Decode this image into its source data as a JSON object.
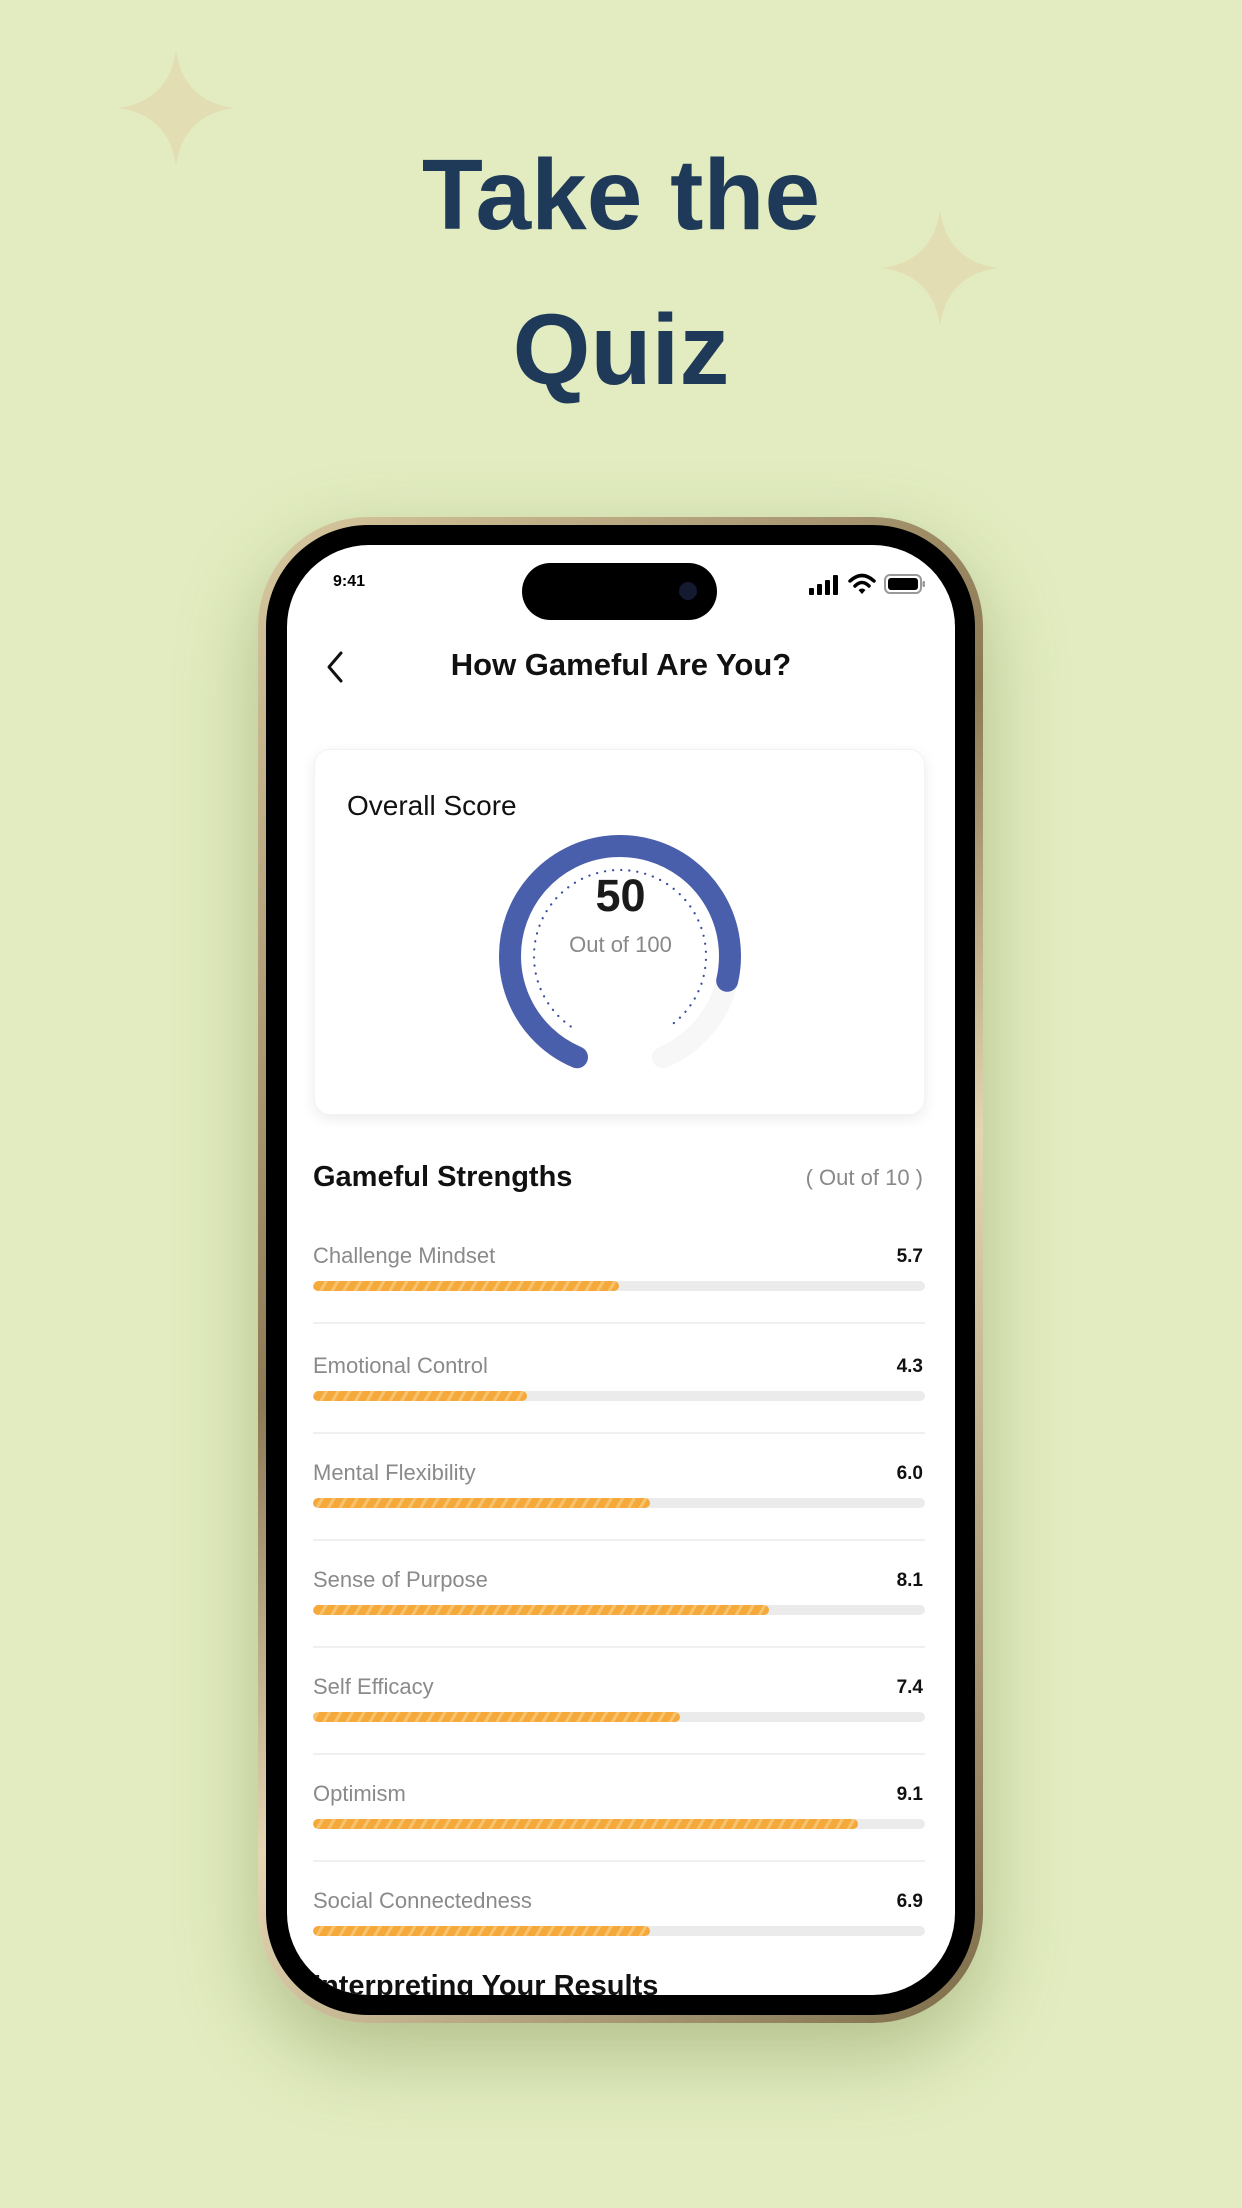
{
  "headline": {
    "line1": "Take the",
    "line2": "Quiz"
  },
  "status_bar": {
    "time": "9:41",
    "icons": [
      "signal-icon",
      "wifi-icon",
      "battery-icon"
    ]
  },
  "header": {
    "title": "How Gameful Are You?",
    "back_icon": "chevron-left-icon"
  },
  "overall": {
    "title": "Overall Score",
    "score": "50",
    "out_of": "Out of 100",
    "color": "#4a5fab"
  },
  "strengths": {
    "title": "Gameful Strengths",
    "note": "( Out of 10 )",
    "bar_color": "#f4a93a",
    "items": [
      {
        "label": "Challenge Mindset",
        "value": "5.7",
        "fill": 0.5
      },
      {
        "label": "Emotional Control",
        "value": "4.3",
        "fill": 0.35
      },
      {
        "label": "Mental Flexibility",
        "value": "6.0",
        "fill": 0.55
      },
      {
        "label": "Sense of Purpose",
        "value": "8.1",
        "fill": 0.745
      },
      {
        "label": "Self Efficacy",
        "value": "7.4",
        "fill": 0.6
      },
      {
        "label": "Optimism",
        "value": "9.1",
        "fill": 0.89
      },
      {
        "label": "Social Connectedness",
        "value": "6.9",
        "fill": 0.55
      }
    ]
  },
  "next_section": {
    "title": "Interpreting Your Results"
  }
}
